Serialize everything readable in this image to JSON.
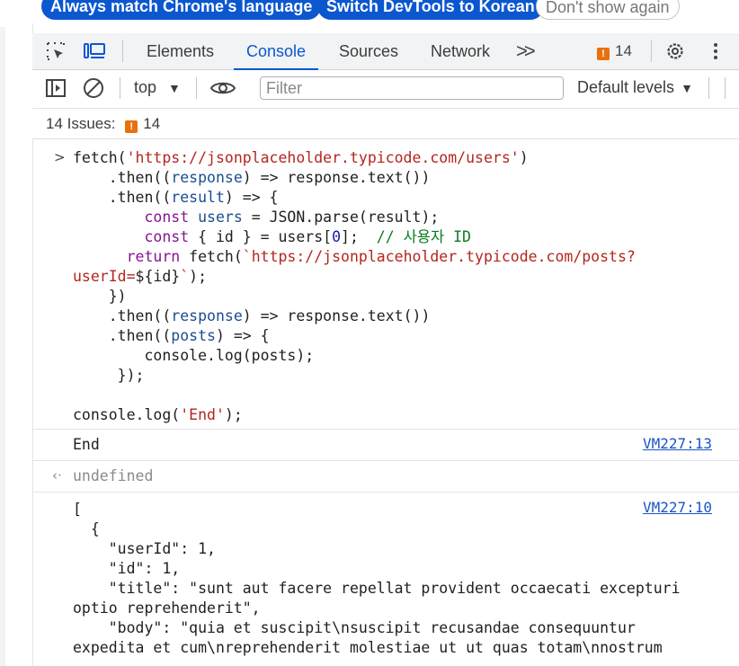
{
  "infobar": {
    "match_language_label": "Always match Chrome's language",
    "switch_language_label": "Switch DevTools to Korean",
    "dont_show_label": "Don't show again"
  },
  "tabs": [
    {
      "label": "Elements"
    },
    {
      "label": "Console"
    },
    {
      "label": "Sources"
    },
    {
      "label": "Network"
    }
  ],
  "active_tab": "Console",
  "issues_count": "14",
  "filterbar": {
    "context": "top",
    "filter_placeholder": "Filter",
    "levels_label": "Default levels"
  },
  "issues_bar": {
    "label": "14 Issues:",
    "count": "14"
  },
  "console": {
    "command_lines": [
      "fetch('https://jsonplaceholder.typicode.com/users')",
      "    .then((response) => response.text())",
      "    .then((result) => {",
      "        const users = JSON.parse(result);",
      "        const { id } = users[0];  // 사용자 ID",
      "      return fetch(`https://jsonplaceholder.typicode.com/posts?",
      "userId=${id}`);",
      "    })",
      "    .then((response) => response.text())",
      "    .then((posts) => {",
      "        console.log(posts);",
      "     });",
      "",
      "console.log('End');"
    ],
    "log_end": {
      "text": "End",
      "source": "VM227:13"
    },
    "return_value": "undefined",
    "log_posts": {
      "source": "VM227:10",
      "lines": [
        "[",
        "  {",
        "    \"userId\": 1,",
        "    \"id\": 1,",
        "    \"title\": \"sunt aut facere repellat provident occaecati excepturi",
        "optio reprehenderit\",",
        "    \"body\": \"quia et suscipit\\nsuscipit recusandae consequuntur",
        "expedita et cum\\nreprehenderit molestiae ut ut quas totam\\nnostrum"
      ]
    }
  },
  "colors": {
    "accent": "#0b57d0",
    "string": "#b3261e",
    "keyword": "#881391",
    "comment": "#0a7d1f",
    "issue": "#e8710a"
  }
}
